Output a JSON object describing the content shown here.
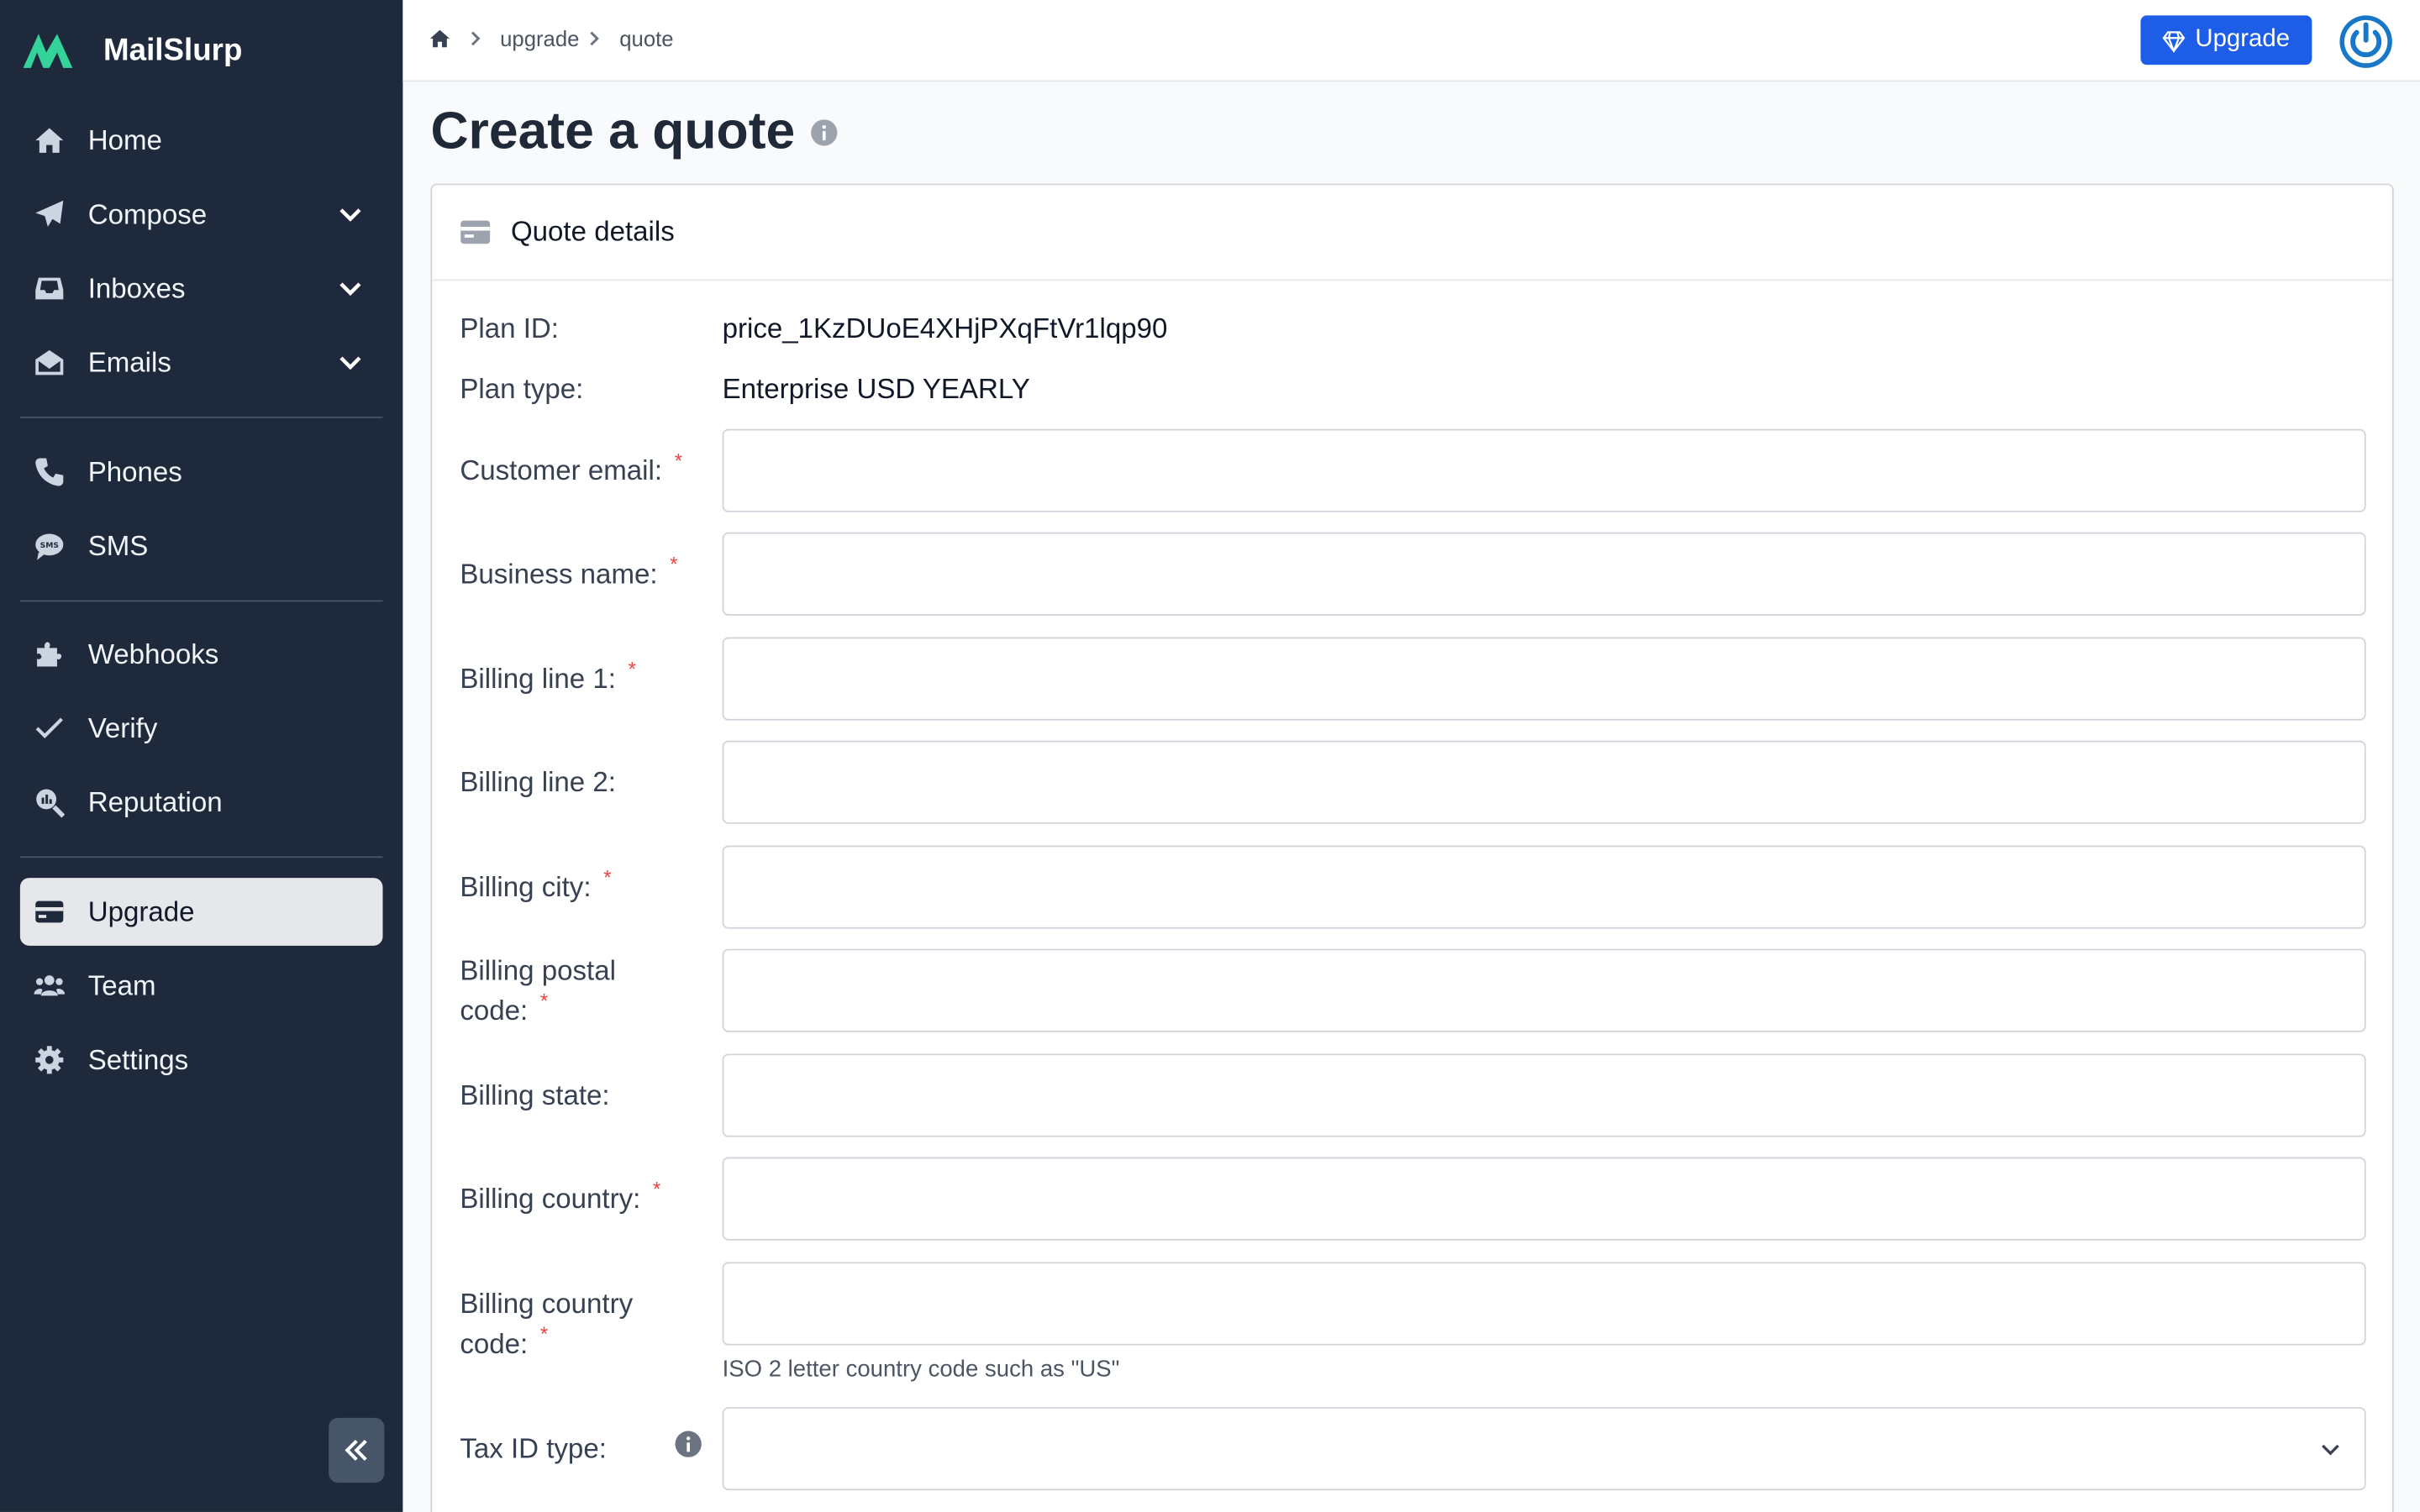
{
  "app": {
    "name": "MailSlurp"
  },
  "sidebar": {
    "items": [
      {
        "label": "Home",
        "icon": "home-icon"
      },
      {
        "label": "Compose",
        "icon": "paper-plane-icon",
        "expandable": true
      },
      {
        "label": "Inboxes",
        "icon": "inbox-icon",
        "expandable": true
      },
      {
        "label": "Emails",
        "icon": "envelope-open-icon",
        "expandable": true
      },
      {
        "label": "Phones",
        "icon": "phone-icon"
      },
      {
        "label": "SMS",
        "icon": "sms-icon"
      },
      {
        "label": "Webhooks",
        "icon": "puzzle-icon"
      },
      {
        "label": "Verify",
        "icon": "check-icon"
      },
      {
        "label": "Reputation",
        "icon": "search-chart-icon"
      },
      {
        "label": "Upgrade",
        "icon": "credit-card-icon",
        "active": true
      },
      {
        "label": "Team",
        "icon": "users-icon"
      },
      {
        "label": "Settings",
        "icon": "gear-icon"
      }
    ]
  },
  "breadcrumb": {
    "items": [
      "upgrade",
      "quote"
    ]
  },
  "header": {
    "upgrade_label": "Upgrade"
  },
  "page": {
    "title": "Create a quote"
  },
  "card": {
    "title": "Quote details",
    "plan_id_label": "Plan ID:",
    "plan_id_value": "price_1KzDUoE4XHjPXqFtVr1lqp90",
    "plan_type_label": "Plan type:",
    "plan_type_value": "Enterprise USD YEARLY",
    "fields": [
      {
        "label": "Customer email:",
        "required": true,
        "value": ""
      },
      {
        "label": "Business name:",
        "required": true,
        "value": ""
      },
      {
        "label": "Billing line 1:",
        "required": true,
        "value": ""
      },
      {
        "label": "Billing line 2:",
        "required": false,
        "value": ""
      },
      {
        "label": "Billing city:",
        "required": true,
        "value": ""
      },
      {
        "label_line1": "Billing postal",
        "label_line2": "code:",
        "required": true,
        "value": ""
      },
      {
        "label": "Billing state:",
        "required": false,
        "value": ""
      },
      {
        "label": "Billing country:",
        "required": true,
        "value": ""
      },
      {
        "label_line1": "Billing country",
        "label_line2": "code:",
        "required": true,
        "value": "",
        "hint": "ISO 2 letter country code such as \"US\""
      },
      {
        "label": "Tax ID type:",
        "required": false,
        "value": ""
      }
    ]
  },
  "colors": {
    "sidebar_bg": "#1e293b",
    "accent": "#1d5de8",
    "brand_green": "#34d399"
  }
}
